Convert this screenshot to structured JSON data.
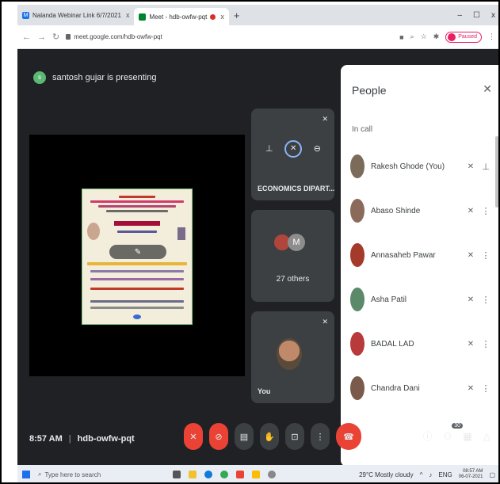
{
  "browser": {
    "tabs": [
      {
        "label": "Nalanda Webinar Link 6/7/2021",
        "close": "x",
        "favicon_color": "#1a73e8"
      },
      {
        "label": "Meet - hdb-owfw-pqt",
        "close": "x",
        "favicon_color": "#00832d"
      }
    ],
    "new_tab": "+",
    "window_controls": [
      "–",
      "☐",
      "x"
    ],
    "url": "meet.google.com/hdb-owfw-pqt",
    "profile_label": "Paused"
  },
  "meet": {
    "presenting_initial": "s",
    "presenting_text": "santosh gujar is presenting",
    "tiles": [
      {
        "label": "ECONOMICS DIPART...",
        "kind": "presenter"
      },
      {
        "label": "27 others",
        "kind": "others",
        "avatar_letter": "M"
      },
      {
        "label": "You",
        "kind": "self"
      }
    ],
    "people_panel": {
      "title": "People",
      "section": "In call",
      "members": [
        {
          "name": "Rakesh Ghode (You)",
          "avatar_color": "#7a6b5a"
        },
        {
          "name": "Abaso Shinde",
          "avatar_color": "#8a6a5a"
        },
        {
          "name": "Annasaheb Pawar",
          "avatar_color": "#a33a2a"
        },
        {
          "name": "Asha Patil",
          "avatar_color": "#5a8a6a"
        },
        {
          "name": "BADAL LAD",
          "avatar_color": "#b83a3a"
        },
        {
          "name": "Chandra Dani",
          "avatar_color": "#7a5a4a"
        }
      ]
    },
    "meeting_time": "8:57 AM",
    "meeting_separator": "|",
    "meeting_code": "hdb-owfw-pqt",
    "participant_count": "30",
    "colors": {
      "danger": "#ea4335",
      "surface": "#3c4043",
      "background": "#202124",
      "accent": "#8ab4f8"
    }
  },
  "taskbar": {
    "search_placeholder": "Type here to search",
    "weather": "29°C Mostly cloudy",
    "language": "ENG",
    "time": "08:57 AM",
    "date": "06-07-2021"
  }
}
